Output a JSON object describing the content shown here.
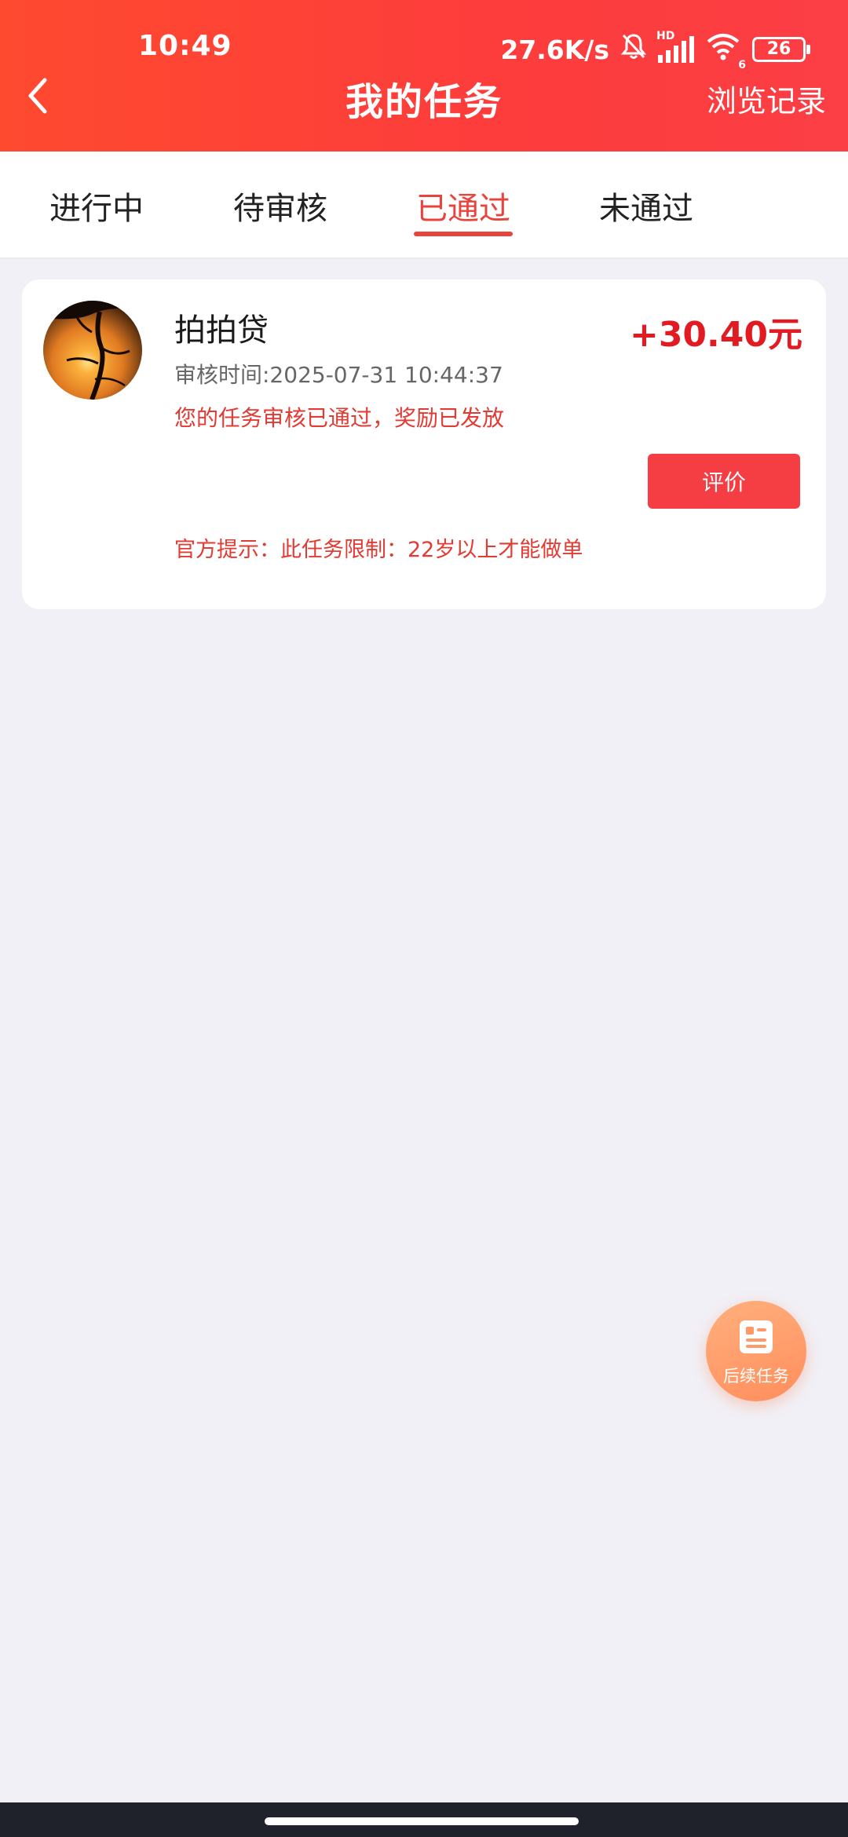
{
  "status_bar": {
    "time": "10:49",
    "net_speed": "27.6K/s",
    "hd_label": "HD",
    "wifi_label": "6",
    "battery": "26"
  },
  "header": {
    "title": "我的任务",
    "history_label": "浏览记录"
  },
  "tabs": [
    {
      "label": "进行中",
      "active": false
    },
    {
      "label": "待审核",
      "active": false
    },
    {
      "label": "已通过",
      "active": true
    },
    {
      "label": "未通过",
      "active": false
    }
  ],
  "task_card": {
    "name": "拍拍贷",
    "reward": "+30.40元",
    "review_time": "审核时间:2025-07-31 10:44:37",
    "status_message": "您的任务审核已通过，奖励已发放",
    "rate_button_label": "评价",
    "official_tip": "官方提示：此任务限制：22岁以上才能做单"
  },
  "fab": {
    "label": "后续任务",
    "icon": "document-list-icon"
  },
  "colors": {
    "accent": "#e8433c",
    "reward": "#e21b22",
    "header_gradient_start": "#fe4a2f",
    "header_gradient_end": "#fb3f45",
    "fab": "#ff9a68"
  }
}
